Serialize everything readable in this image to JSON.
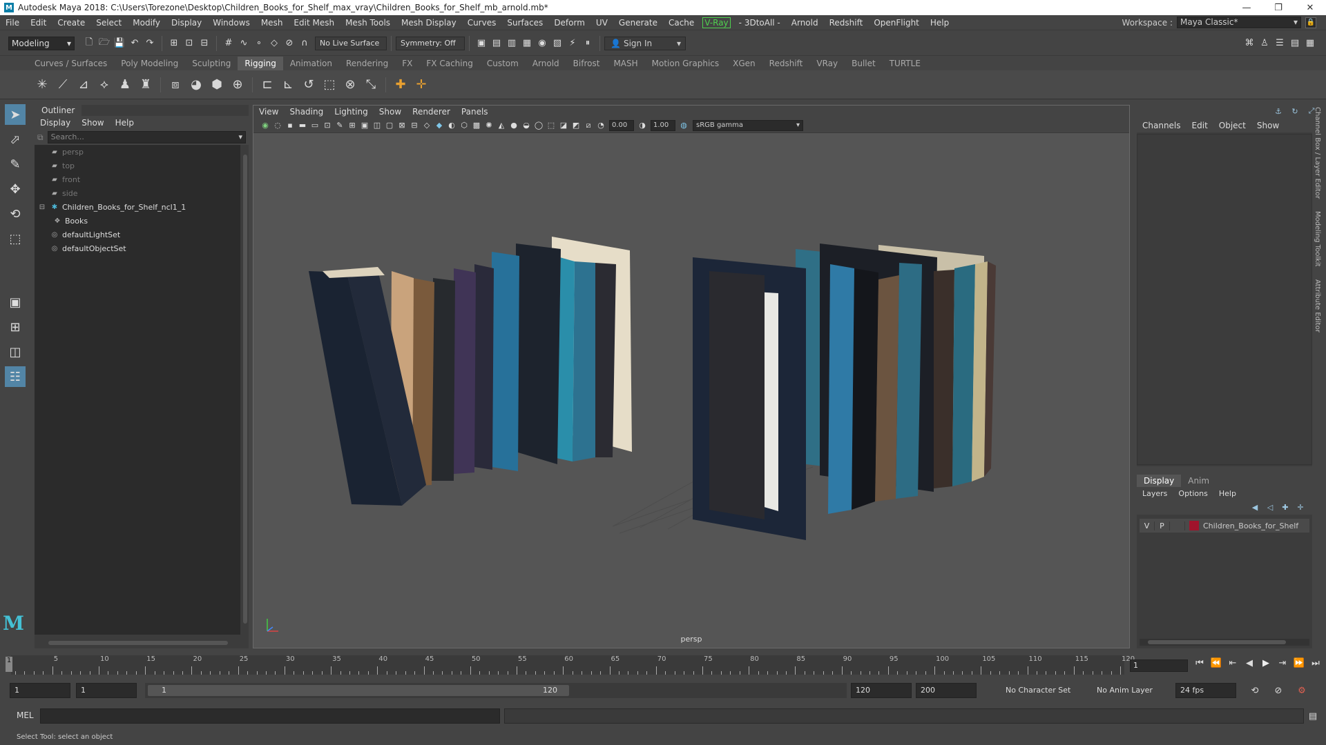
{
  "window": {
    "title": "Autodesk Maya 2018: C:\\Users\\Torezone\\Desktop\\Children_Books_for_Shelf_max_vray\\Children_Books_for_Shelf_mb_arnold.mb*",
    "minimize": "—",
    "restore": "❐",
    "close": "✕"
  },
  "menubar": {
    "items": [
      "File",
      "Edit",
      "Create",
      "Select",
      "Modify",
      "Display",
      "Windows",
      "Mesh",
      "Edit Mesh",
      "Mesh Tools",
      "Mesh Display",
      "Curves",
      "Surfaces",
      "Deform",
      "UV",
      "Generate",
      "Cache",
      "V-Ray",
      "- 3DtoAll -",
      "Arnold",
      "Redshift",
      "OpenFlight",
      "Help"
    ],
    "workspace_label": "Workspace :",
    "workspace_value": "Maya Classic*"
  },
  "statusline": {
    "mode": "Modeling",
    "live_surface": "No Live Surface",
    "symmetry": "Symmetry: Off",
    "sign_in": "Sign In"
  },
  "shelf": {
    "tabs": [
      "Curves / Surfaces",
      "Poly Modeling",
      "Sculpting",
      "Rigging",
      "Animation",
      "Rendering",
      "FX",
      "FX Caching",
      "Custom",
      "Arnold",
      "Bifrost",
      "MASH",
      "Motion Graphics",
      "XGen",
      "Redshift",
      "VRay",
      "Bullet",
      "TURTLE"
    ],
    "active_tab": "Rigging"
  },
  "outliner": {
    "title": "Outliner",
    "menu": [
      "Display",
      "Show",
      "Help"
    ],
    "search_placeholder": "Search...",
    "items": [
      {
        "label": "persp",
        "dim": true
      },
      {
        "label": "top",
        "dim": true
      },
      {
        "label": "front",
        "dim": true
      },
      {
        "label": "side",
        "dim": true
      },
      {
        "label": "Children_Books_for_Shelf_ncl1_1",
        "dim": false
      },
      {
        "label": "Books",
        "dim": false
      },
      {
        "label": "defaultLightSet",
        "dim": false
      },
      {
        "label": "defaultObjectSet",
        "dim": false
      }
    ]
  },
  "viewport": {
    "menu": [
      "View",
      "Shading",
      "Lighting",
      "Show",
      "Renderer",
      "Panels"
    ],
    "exposure": "0.00",
    "gamma": "1.00",
    "color_space": "sRGB gamma",
    "camera": "persp"
  },
  "channelbox": {
    "menu": [
      "Channels",
      "Edit",
      "Object",
      "Show"
    ],
    "side_tabs": [
      "Channel Box / Layer Editor",
      "Modeling Toolkit",
      "Attribute Editor"
    ]
  },
  "layers": {
    "tabs": [
      "Display",
      "Anim"
    ],
    "menu": [
      "Layers",
      "Options",
      "Help"
    ],
    "rows": [
      {
        "v": "V",
        "p": "P",
        "name": "Children_Books_for_Shelf",
        "color": "#a0142c"
      }
    ]
  },
  "timeline": {
    "ticks": [
      5,
      10,
      15,
      20,
      25,
      30,
      35,
      40,
      45,
      50,
      55,
      60,
      65,
      70,
      75,
      80,
      85,
      90,
      95,
      100,
      105,
      110,
      115,
      120
    ],
    "current_marker": "1",
    "current_frame": "1"
  },
  "range": {
    "start": "1",
    "anim_start": "1",
    "range_start": "1",
    "range_end": "120",
    "end": "120",
    "anim_end": "200",
    "character_set": "No Character Set",
    "anim_layer": "No Anim Layer",
    "fps": "24 fps"
  },
  "command": {
    "label": "MEL"
  },
  "help_line": "Select Tool: select an object"
}
